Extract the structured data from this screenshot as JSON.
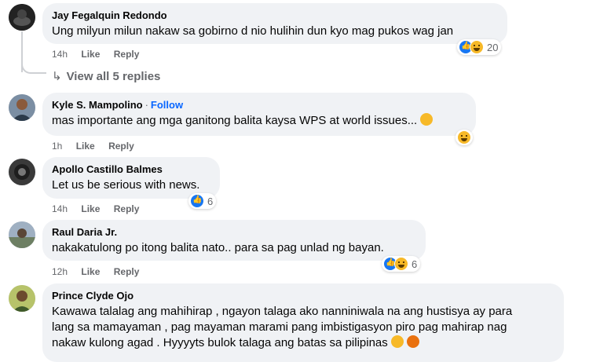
{
  "comments": [
    {
      "author": "Jay Fegalquin Redondo",
      "text": "Ung milyun milun nakaw sa gobirno d nio hulihin dun kyo mag pukos wag jan",
      "time": "14h",
      "like": "Like",
      "reply": "Reply",
      "reaction_count": "20"
    },
    {
      "author": "Kyle S. Mampolino",
      "follow": "Follow",
      "text": "mas importante ang mga ganitong balita kaysa WPS at world issues...",
      "time": "1h",
      "like": "Like",
      "reply": "Reply"
    },
    {
      "author": "Apollo Castillo Balmes",
      "text": "Let us be serious with news.",
      "time": "14h",
      "like": "Like",
      "reply": "Reply",
      "reaction_count": "6"
    },
    {
      "author": "Raul Daria Jr.",
      "text": "nakakatulong po itong balita nato.. para sa pag unlad ng bayan.",
      "time": "12h",
      "like": "Like",
      "reply": "Reply",
      "reaction_count": "6"
    },
    {
      "author": "Prince Clyde Ojo",
      "text_lines": [
        "Kawawa talalag ang mahihirap , ngayon talaga ako nanniniwala na ang hustisya ay para",
        "lang sa mamayaman , pag mayaman marami pang imbistigasyon piro pag mahirap nag",
        "nakaw kulong agad . Hyyyyts bulok talaga ang batas sa pilipinas"
      ]
    }
  ],
  "view_replies": "View all 5 replies",
  "colors": {
    "bubble": "#f0f2f5",
    "meta": "#65676b",
    "follow": "#0866ff",
    "like": "#1877f2",
    "haha": "#f7b928"
  }
}
